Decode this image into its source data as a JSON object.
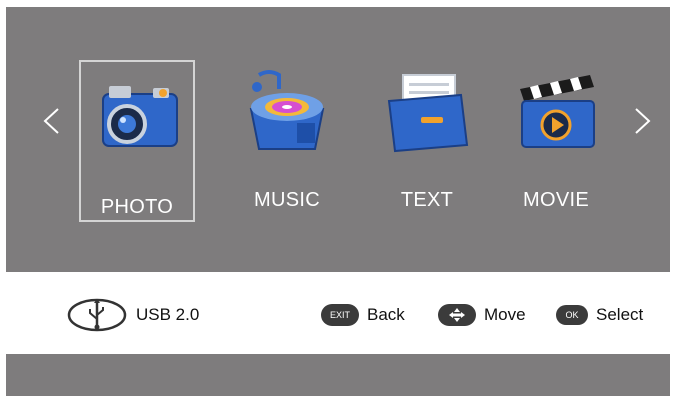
{
  "menu": {
    "items": [
      {
        "label": "PHOTO",
        "icon": "camera-icon",
        "selected": true
      },
      {
        "label": "MUSIC",
        "icon": "music-box-icon",
        "selected": false
      },
      {
        "label": "TEXT",
        "icon": "folder-document-icon",
        "selected": false
      },
      {
        "label": "MOVIE",
        "icon": "clapperboard-icon",
        "selected": false
      }
    ],
    "prev_arrow": "<",
    "next_arrow": ">"
  },
  "footer": {
    "source_label": "USB 2.0",
    "hints": [
      {
        "key": "EXIT",
        "label": "Back"
      },
      {
        "key": "",
        "label": "Move"
      },
      {
        "key": "OK",
        "label": "Select"
      }
    ]
  },
  "colors": {
    "panel": "#7e7c7d",
    "selection_border": "#d4d4d4",
    "label_text": "#ffffff",
    "key_pill": "#3b3b3b"
  }
}
